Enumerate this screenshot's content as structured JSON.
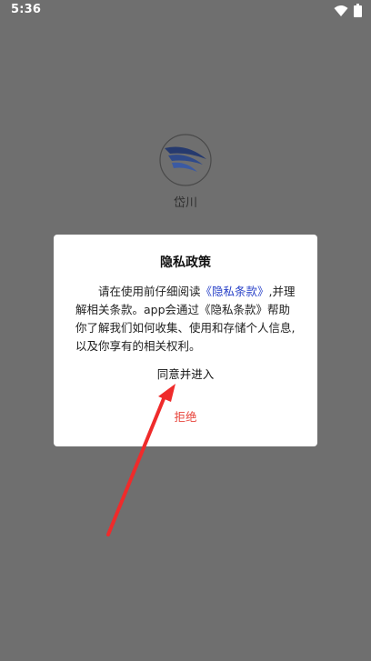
{
  "status_bar": {
    "time": "5:36",
    "wifi_icon": "wifi-icon",
    "battery_icon": "battery-icon"
  },
  "app": {
    "name": "岱川",
    "logo_icon": "app-logo-icon"
  },
  "dialog": {
    "title": "隐私政策",
    "body": {
      "text_before": "请在使用前仔细阅读",
      "link_text": "《隐私条款》",
      "text_after": ",并理解相关条款。app会通过《隐私条款》帮助你了解我们如何收集、使用和存储个人信息,以及你享有的相关权利。"
    },
    "agree_label": "同意并进入",
    "reject_label": "拒绝"
  },
  "colors": {
    "overlay": "#6f6f6f",
    "link": "#2942c8",
    "reject": "#e8453c",
    "annotation_arrow": "#ef2b2b"
  }
}
